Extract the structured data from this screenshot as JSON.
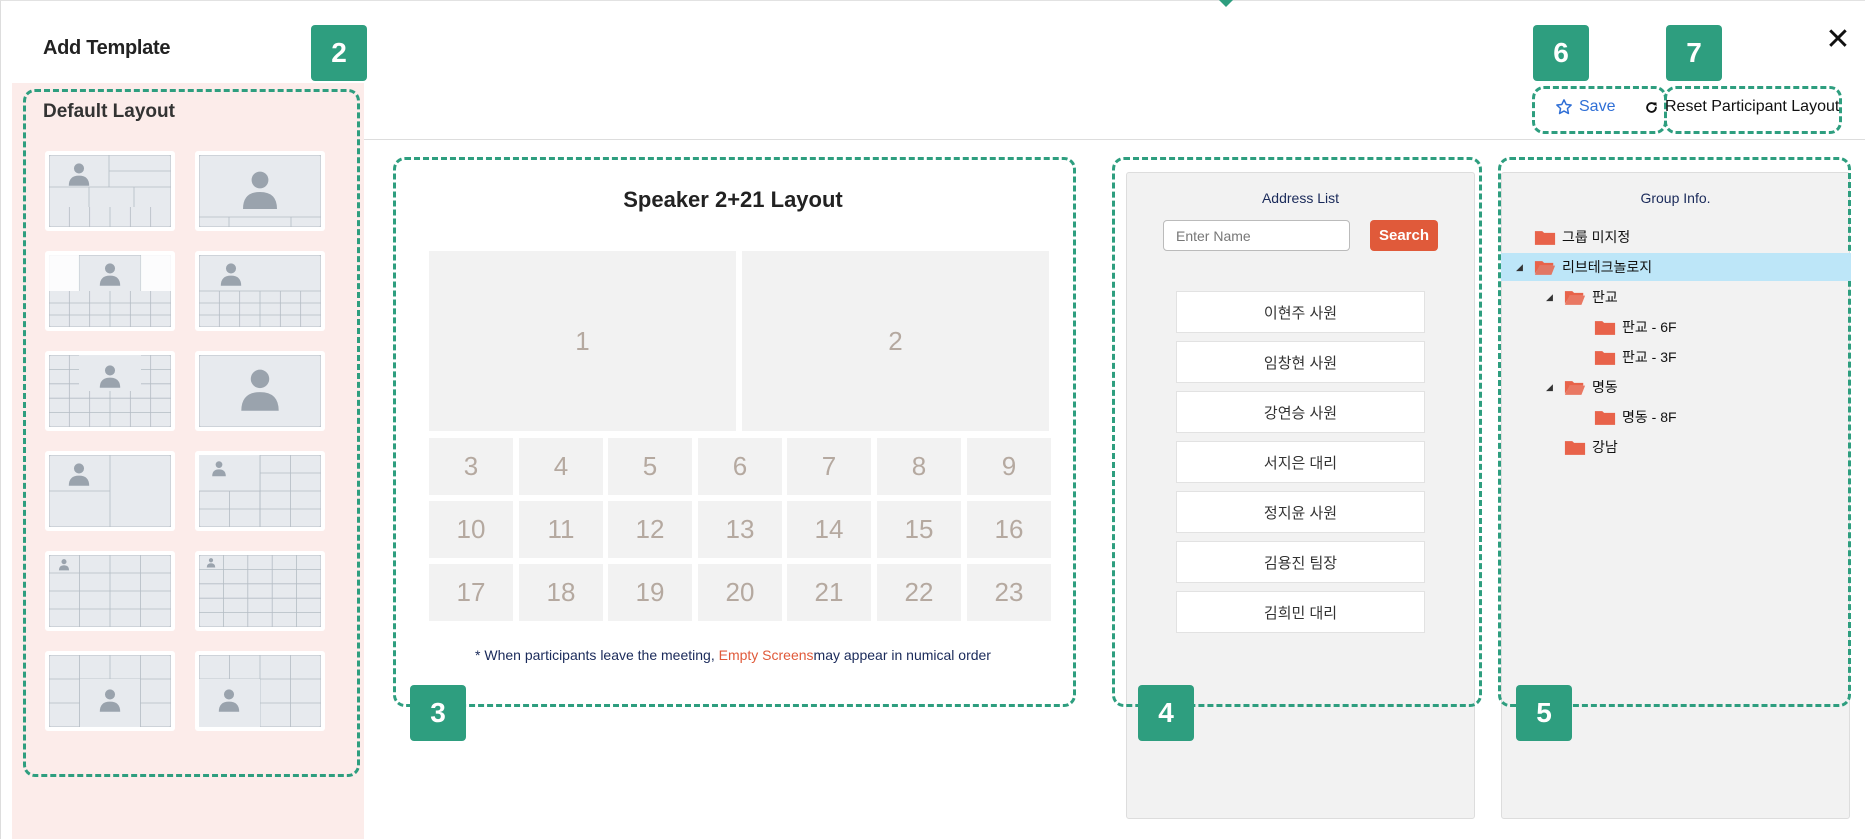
{
  "window": {
    "title": "Add Template",
    "close_label": "✕"
  },
  "badges": {
    "b2": "2",
    "b3": "3",
    "b4": "4",
    "b5": "5",
    "b6": "6",
    "b7": "7"
  },
  "sidebar": {
    "label": "Default Layout",
    "thumbnails": [
      "layout-thumb-1",
      "layout-thumb-2",
      "layout-thumb-3",
      "layout-thumb-4",
      "layout-thumb-5",
      "layout-thumb-6",
      "layout-thumb-7",
      "layout-thumb-8",
      "layout-thumb-9",
      "layout-thumb-10",
      "layout-thumb-11",
      "layout-thumb-12"
    ]
  },
  "toolbar": {
    "save_label": "Save",
    "reset_label": "Reset Participant Layout",
    "save_icon": "star-icon",
    "reset_icon": "refresh-icon"
  },
  "layout": {
    "title": "Speaker 2+21 Layout",
    "cells": [
      "1",
      "2",
      "3",
      "4",
      "5",
      "6",
      "7",
      "8",
      "9",
      "10",
      "11",
      "12",
      "13",
      "14",
      "15",
      "16",
      "17",
      "18",
      "19",
      "20",
      "21",
      "22",
      "23"
    ],
    "note_before": "* When participants leave the meeting, ",
    "note_highlight": "Empty Screens",
    "note_after": "may appear in numical order"
  },
  "address": {
    "title": "Address List",
    "input_placeholder": "Enter Name",
    "search_label": "Search",
    "people": [
      "이현주 사원",
      "임창현 사원",
      "강연승 사원",
      "서지은 대리",
      "정지윤 사원",
      "김용진 팀장",
      "김희민 대리"
    ]
  },
  "group": {
    "title": "Group Info.",
    "tree": [
      {
        "label": "그룹 미지정",
        "depth": 0,
        "expanded": null,
        "selected": false
      },
      {
        "label": "리브테크놀로지",
        "depth": 0,
        "expanded": true,
        "selected": true
      },
      {
        "label": "판교",
        "depth": 1,
        "expanded": true,
        "selected": false
      },
      {
        "label": "판교 - 6F",
        "depth": 2,
        "expanded": null,
        "selected": false
      },
      {
        "label": "판교 - 3F",
        "depth": 2,
        "expanded": null,
        "selected": false
      },
      {
        "label": "명동",
        "depth": 1,
        "expanded": true,
        "selected": false
      },
      {
        "label": "명동 - 8F",
        "depth": 2,
        "expanded": null,
        "selected": false
      },
      {
        "label": "강남",
        "depth": 1,
        "expanded": null,
        "selected": false
      }
    ]
  },
  "colors": {
    "accent": "#2e9e7f",
    "search": "#e05a3a",
    "folder": "#e8634a",
    "selected_row": "#bde6f8",
    "save": "#2f6fd6",
    "sidebar_bg": "#fcecea"
  }
}
